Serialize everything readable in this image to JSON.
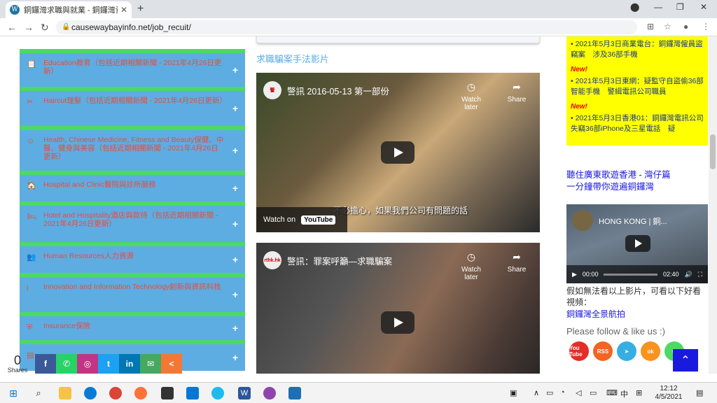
{
  "browser": {
    "tab_title": "銅鑼灣求職與就業 - 銅鑼灣資訊",
    "tab_close": "✕",
    "new_tab": "+",
    "url": "causewaybayinfo.net/job_recuit/"
  },
  "left": {
    "categories": [
      {
        "icon": "📋",
        "label": "Education教育（包括近期相關新聞 - 2021年4月26日更新）"
      },
      {
        "icon": "✂",
        "label": "Haircut理髮（包括近期相關新聞 - 2021年4月26日更新）"
      },
      {
        "icon": "☺",
        "label": "Health, Chinese Medicine, Fitness and Beauty保健、中醫、健身與美容（包括近期相關新聞 - 2021年4月26日更新）"
      },
      {
        "icon": "🏠",
        "label": "Hospital and Clinic醫院與診所服務"
      },
      {
        "icon": "🛏",
        "label": "Hotel and Hospitality酒店與款待（包括近期相關新聞 - 2021年4月26日更新）"
      },
      {
        "icon": "👥",
        "label": "Human Resources人力資源"
      },
      {
        "icon": "i",
        "label": "Innovation and Information Technology創新與資訊科技"
      },
      {
        "icon": "⛨",
        "label": "Insurance保險"
      },
      {
        "icon": "▤",
        "label": ""
      }
    ],
    "plus": "+",
    "share_count": "0",
    "share_label": "Shares",
    "share_buttons": [
      "f",
      "✆",
      "◎",
      "t",
      "in",
      "✉",
      "<"
    ]
  },
  "middle": {
    "section_title": "求職騙案手法影片",
    "videos": [
      {
        "channel": "警",
        "title": "警訊 2016-05-13 第一部份",
        "watch_later": "Watch later",
        "share": "Share",
        "watch_on": "Watch on",
        "youtube": "YouTube",
        "subtitle": "不必擔心，如果我們公司有問題的話"
      },
      {
        "channel": "rthk.hk",
        "title": "警訊：罪案呼籲—求職騙案",
        "watch_later": "Watch later",
        "share": "Share"
      }
    ]
  },
  "right": {
    "news": [
      {
        "text": "2021年5月3日商業電台：銅鑼灣僱員盜竊案　涉及36部手機",
        "new": "New!"
      },
      {
        "text": "2021年5月3日東網：疑監守自盜偷36部智能手機　警緝電訊公司職員",
        "new": "New!"
      },
      {
        "text": "2021年5月3日香港01：銅鑼灣電訊公司失竊36部iPhone及三星電話　疑"
      }
    ],
    "promo_line1": "聽住廣東歌遊香港 - 灣仔篇",
    "promo_line2": "一分鐘帶你遊遍銅鑼灣",
    "video_title": "HONG KONG | 銅...",
    "time_now": "00:00",
    "time_total": "02:40",
    "note": "假如無法看以上影片，可看以下好看視頻：",
    "link": "銅鑼灣全景航拍",
    "follow": "Please follow & like us :)",
    "social": [
      "You Tube",
      "RSS",
      "➤",
      "ok",
      "✆"
    ],
    "to_top": "⌃"
  },
  "taskbar": {
    "lang": "中",
    "time": "12:12",
    "date": "4/5/2021"
  }
}
